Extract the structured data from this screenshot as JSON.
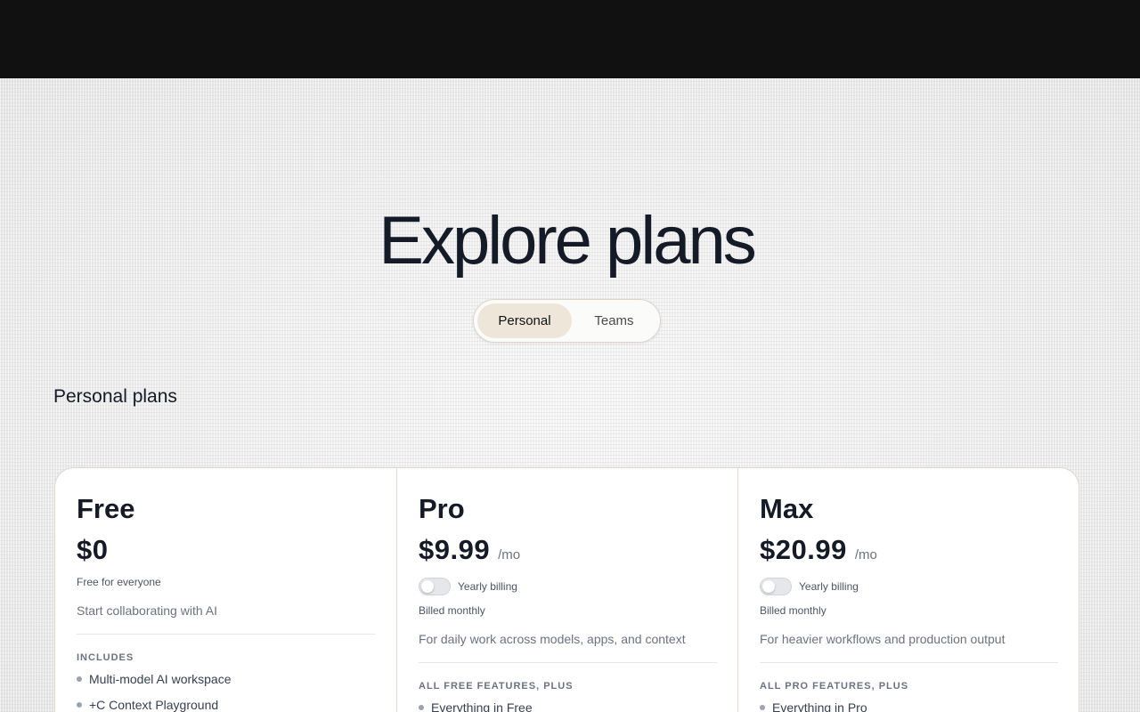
{
  "page": {
    "title": "Explore plans",
    "section_title": "Personal plans"
  },
  "switcher": {
    "options": [
      "Personal",
      "Teams"
    ],
    "selected": "Personal"
  },
  "plans": [
    {
      "name": "Free",
      "price": "$0",
      "note": "Free for everyone",
      "description": "Start collaborating with AI",
      "features_heading": "INCLUDES",
      "features": [
        "Multi-model AI workspace",
        "+C Context Playground"
      ]
    },
    {
      "name": "Pro",
      "price": "$9.99",
      "per": "/mo",
      "toggle_label": "Yearly billing",
      "yearly_billing": false,
      "billing_note": "Billed monthly",
      "description": "For daily work across models, apps, and context",
      "features_heading": "ALL FREE FEATURES, PLUS",
      "features": [
        "Everything in Free"
      ]
    },
    {
      "name": "Max",
      "price": "$20.99",
      "per": "/mo",
      "toggle_label": "Yearly billing",
      "yearly_billing": false,
      "billing_note": "Billed monthly",
      "description": "For heavier workflows and production output",
      "features_heading": "ALL PRO FEATURES, PLUS",
      "features": [
        "Everything in Pro"
      ]
    }
  ],
  "colors": {
    "topbar": "#111111",
    "selected_pill": "#efe6da",
    "title_text": "#141a26"
  }
}
